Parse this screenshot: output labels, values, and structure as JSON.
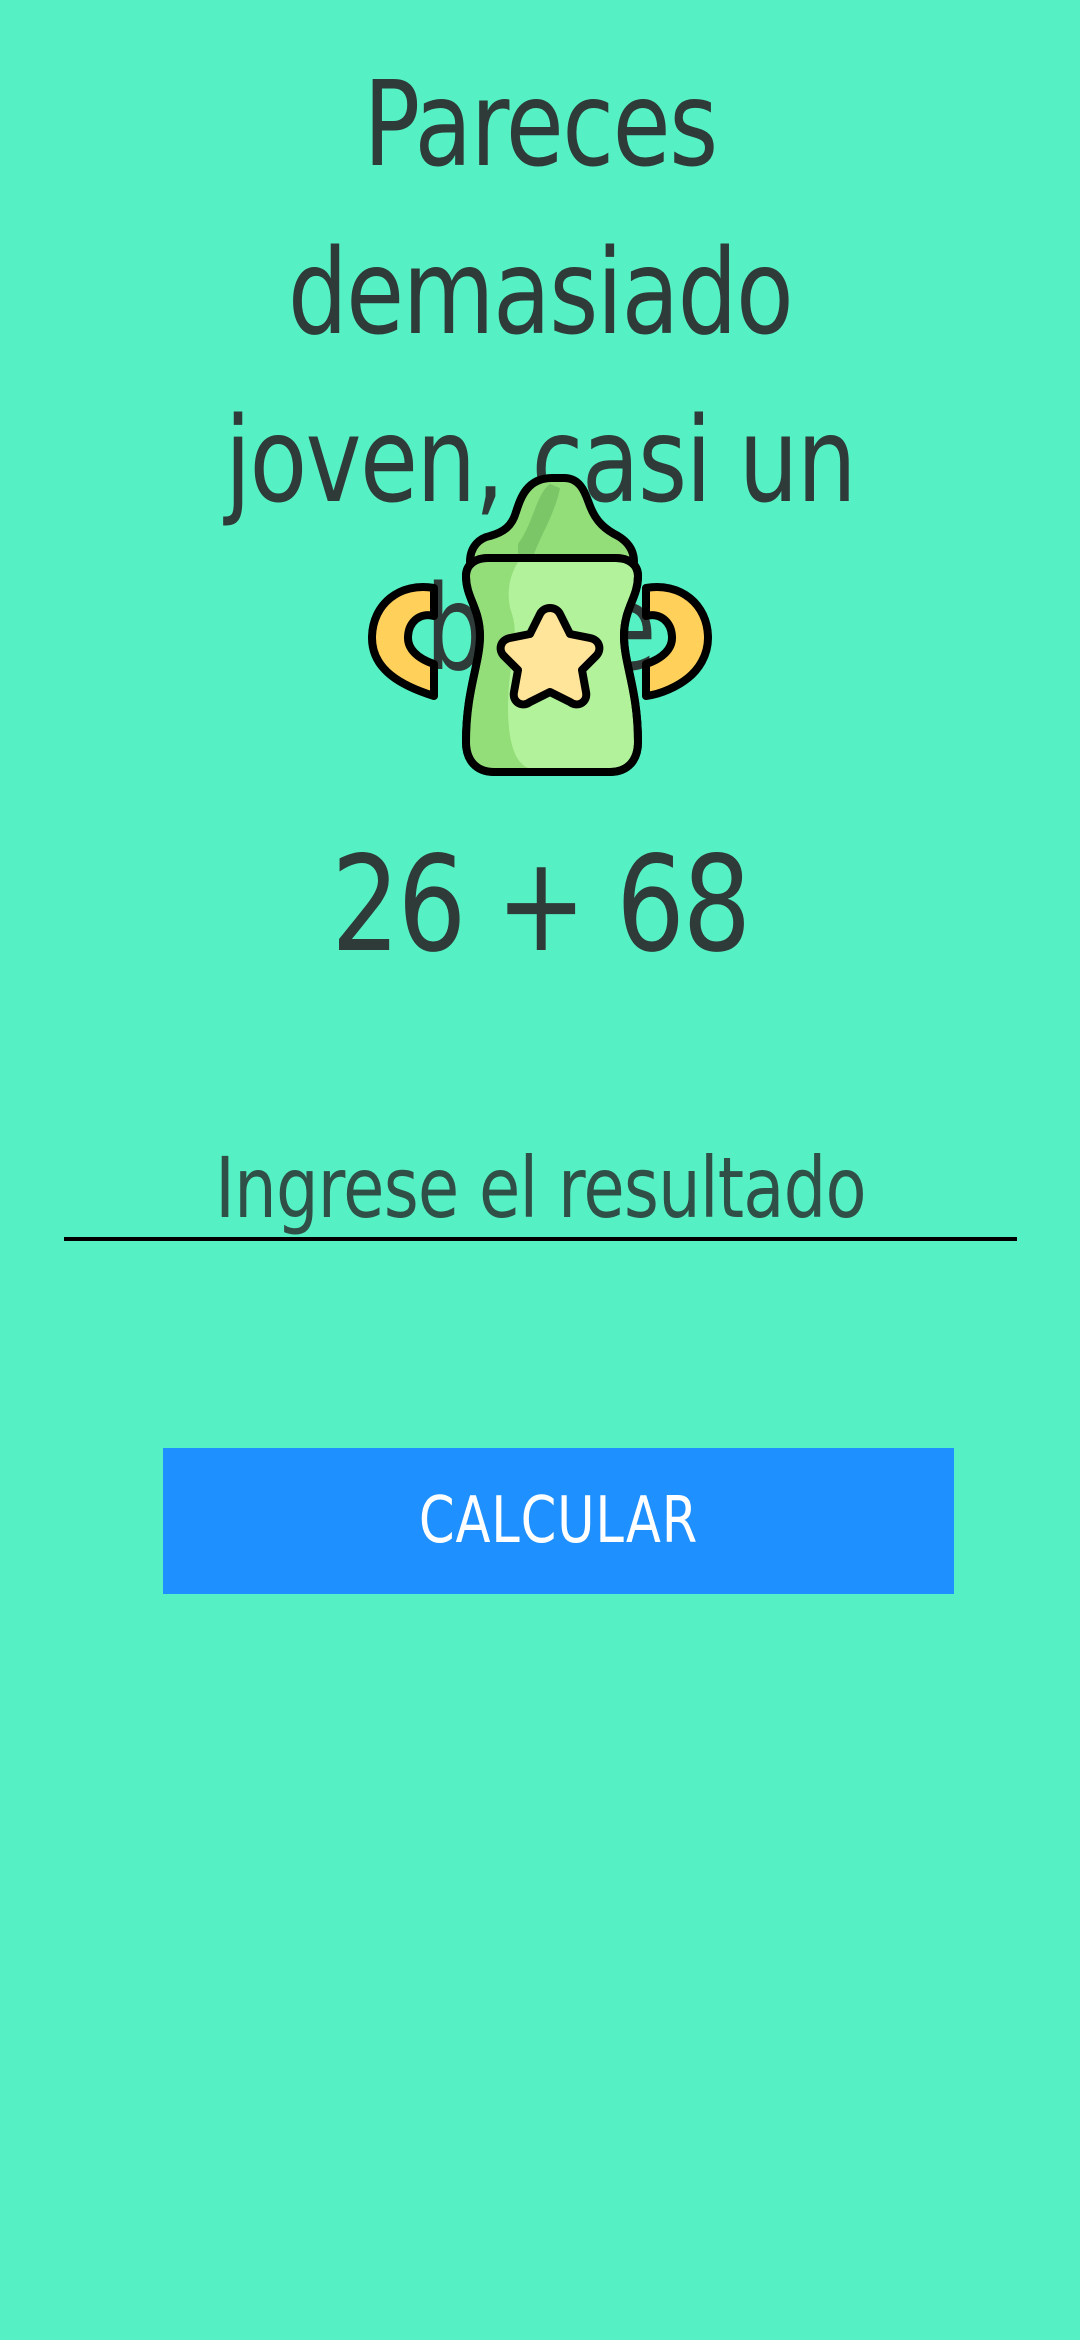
{
  "app": {
    "title_line_1": "Pareces demasiado",
    "title_line_2": "joven, casi un bebe",
    "illustration": "baby-bottle-icon",
    "equation": "26 + 68",
    "answer_placeholder": "Ingrese el resultado",
    "answer_value": "",
    "button_label": "CALCULAR"
  },
  "colors": {
    "background": "#55F0C3",
    "text": "#2F3B38",
    "button": "#1E90FF",
    "button_text": "#FFFFFF"
  }
}
